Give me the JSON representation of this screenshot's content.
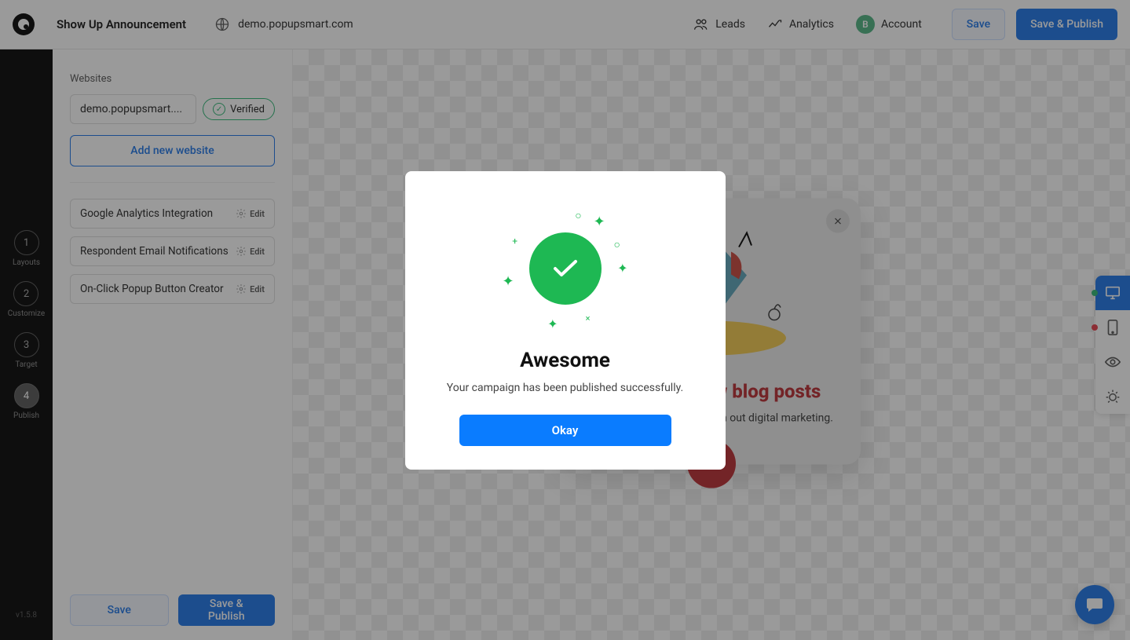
{
  "header": {
    "campaign_name": "Show Up Announcement",
    "url": "demo.popupsmart.com",
    "leads_label": "Leads",
    "analytics_label": "Analytics",
    "account_label": "Account",
    "account_initial": "B",
    "save_label": "Save",
    "save_publish_label": "Save & Publish"
  },
  "steps": [
    {
      "num": "1",
      "label": "Layouts"
    },
    {
      "num": "2",
      "label": "Customize"
    },
    {
      "num": "3",
      "label": "Target"
    },
    {
      "num": "4",
      "label": "Publish"
    }
  ],
  "version": "v1.5.8",
  "sidebar": {
    "websites_label": "Websites",
    "website_value": "demo.popupsmart....",
    "verified_label": "Verified",
    "add_website_label": "Add new website",
    "integrations": [
      {
        "name": "Google Analytics Integration",
        "edit": "Edit"
      },
      {
        "name": "Respondent Email Notifications",
        "edit": "Edit"
      },
      {
        "name": "On-Click Popup Button Creator",
        "edit": "Edit"
      }
    ],
    "save_label": "Save",
    "save_publish_label": "Save & Publish"
  },
  "popup_preview": {
    "title": "Check our new blog posts",
    "text": "Inspired by you! Check them out digital marketing."
  },
  "modal": {
    "title": "Awesome",
    "text": "Your campaign has been published successfully.",
    "button": "Okay"
  }
}
